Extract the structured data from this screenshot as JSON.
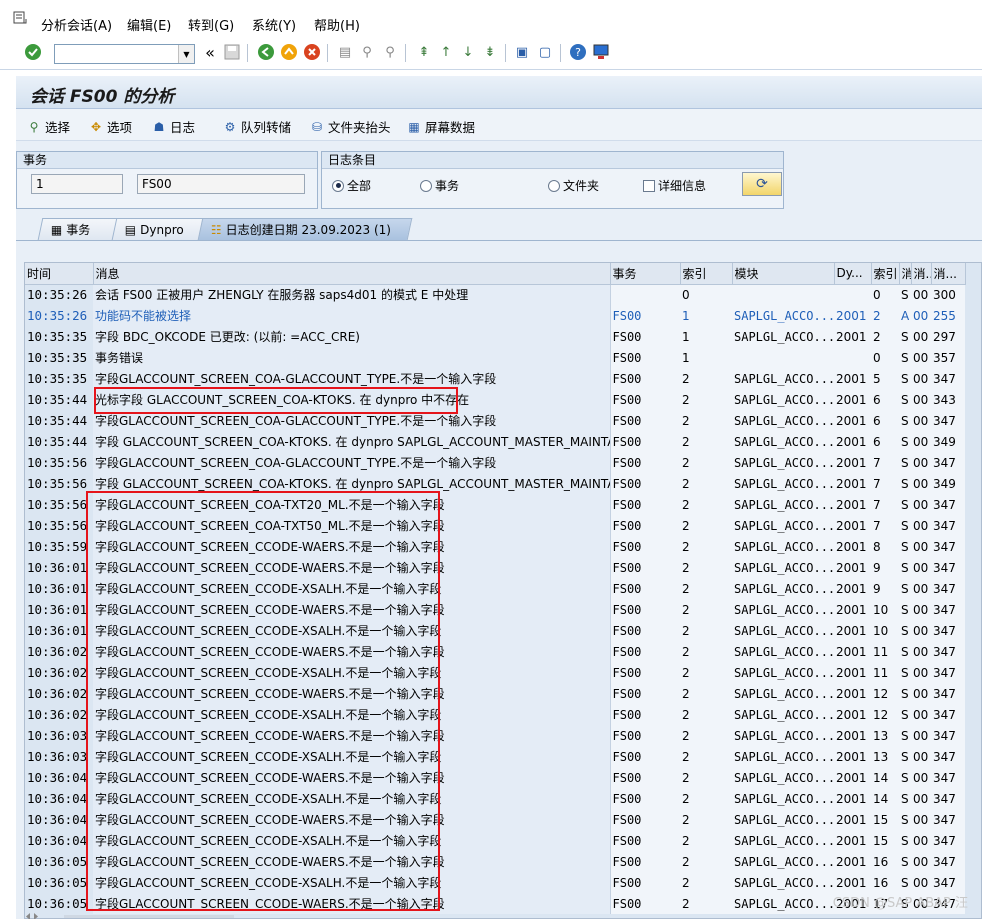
{
  "menu": {
    "items": [
      "分析会话(A)",
      "编辑(E)",
      "转到(G)",
      "系统(Y)",
      "帮助(H)"
    ]
  },
  "toolbar": {
    "command_value": "",
    "back_glyph": "«"
  },
  "title": "会话 FS00 的分析",
  "app_toolbar": {
    "buttons": [
      "选择",
      "选项",
      "日志",
      "队列转储",
      "文件夹抬头",
      "屏幕数据"
    ]
  },
  "transaction_group": {
    "header": "事务",
    "field1": "1",
    "field2": "FS00"
  },
  "log_group": {
    "header": "日志条目",
    "options": [
      "全部",
      "事务",
      "文件夹"
    ],
    "selected": "全部",
    "checkbox_label": "详细信息"
  },
  "tabs": [
    "事务",
    "Dynpro",
    "日志创建日期 23.09.2023 (1)"
  ],
  "table": {
    "headers": [
      "时间",
      "消息",
      "事务",
      "索引",
      "模块",
      "Dy...",
      "索引",
      "消",
      "消...",
      "消..."
    ],
    "rows": [
      [
        "10:35:26",
        "会话 FS00 正被用户 ZHENGLY 在服务器 saps4d01 的模式 E 中处理",
        "",
        "0",
        "",
        "",
        "0",
        "S",
        "00",
        "300"
      ],
      [
        "10:35:26",
        "功能码不能被选择",
        "FS00",
        "1",
        "SAPLGL_ACCO...",
        "2001",
        "2",
        "A",
        "00",
        "255"
      ],
      [
        "10:35:35",
        "字段 BDC_OKCODE 已更改: (以前: =ACC_CRE)",
        "FS00",
        "1",
        "SAPLGL_ACCO...",
        "2001",
        "2",
        "S",
        "00",
        "297"
      ],
      [
        "10:35:35",
        "事务错误",
        "FS00",
        "1",
        "",
        "",
        "0",
        "S",
        "00",
        "357"
      ],
      [
        "10:35:35",
        "字段GLACCOUNT_SCREEN_COA-GLACCOUNT_TYPE.不是一个输入字段",
        "FS00",
        "2",
        "SAPLGL_ACCO...",
        "2001",
        "5",
        "S",
        "00",
        "347"
      ],
      [
        "10:35:44",
        "光标字段 GLACCOUNT_SCREEN_COA-KTOKS. 在 dynpro 中不存在",
        "FS00",
        "2",
        "SAPLGL_ACCO...",
        "2001",
        "6",
        "S",
        "00",
        "343"
      ],
      [
        "10:35:44",
        "字段GLACCOUNT_SCREEN_COA-GLACCOUNT_TYPE.不是一个输入字段",
        "FS00",
        "2",
        "SAPLGL_ACCO...",
        "2001",
        "6",
        "S",
        "00",
        "347"
      ],
      [
        "10:35:44",
        "字段 GLACCOUNT_SCREEN_COA-KTOKS. 在 dynpro SAPLGL_ACCOUNT_MASTER_MAINTAIN...",
        "FS00",
        "2",
        "SAPLGL_ACCO...",
        "2001",
        "6",
        "S",
        "00",
        "349"
      ],
      [
        "10:35:56",
        "字段GLACCOUNT_SCREEN_COA-GLACCOUNT_TYPE.不是一个输入字段",
        "FS00",
        "2",
        "SAPLGL_ACCO...",
        "2001",
        "7",
        "S",
        "00",
        "347"
      ],
      [
        "10:35:56",
        "字段 GLACCOUNT_SCREEN_COA-KTOKS. 在 dynpro SAPLGL_ACCOUNT_MASTER_MAINTAIN...",
        "FS00",
        "2",
        "SAPLGL_ACCO...",
        "2001",
        "7",
        "S",
        "00",
        "349"
      ],
      [
        "10:35:56",
        "字段GLACCOUNT_SCREEN_COA-TXT20_ML.不是一个输入字段",
        "FS00",
        "2",
        "SAPLGL_ACCO...",
        "2001",
        "7",
        "S",
        "00",
        "347"
      ],
      [
        "10:35:56",
        "字段GLACCOUNT_SCREEN_COA-TXT50_ML.不是一个输入字段",
        "FS00",
        "2",
        "SAPLGL_ACCO...",
        "2001",
        "7",
        "S",
        "00",
        "347"
      ],
      [
        "10:35:59",
        "字段GLACCOUNT_SCREEN_CCODE-WAERS.不是一个输入字段",
        "FS00",
        "2",
        "SAPLGL_ACCO...",
        "2001",
        "8",
        "S",
        "00",
        "347"
      ],
      [
        "10:36:01",
        "字段GLACCOUNT_SCREEN_CCODE-WAERS.不是一个输入字段",
        "FS00",
        "2",
        "SAPLGL_ACCO...",
        "2001",
        "9",
        "S",
        "00",
        "347"
      ],
      [
        "10:36:01",
        "字段GLACCOUNT_SCREEN_CCODE-XSALH.不是一个输入字段",
        "FS00",
        "2",
        "SAPLGL_ACCO...",
        "2001",
        "9",
        "S",
        "00",
        "347"
      ],
      [
        "10:36:01",
        "字段GLACCOUNT_SCREEN_CCODE-WAERS.不是一个输入字段",
        "FS00",
        "2",
        "SAPLGL_ACCO...",
        "2001",
        "10",
        "S",
        "00",
        "347"
      ],
      [
        "10:36:01",
        "字段GLACCOUNT_SCREEN_CCODE-XSALH.不是一个输入字段",
        "FS00",
        "2",
        "SAPLGL_ACCO...",
        "2001",
        "10",
        "S",
        "00",
        "347"
      ],
      [
        "10:36:02",
        "字段GLACCOUNT_SCREEN_CCODE-WAERS.不是一个输入字段",
        "FS00",
        "2",
        "SAPLGL_ACCO...",
        "2001",
        "11",
        "S",
        "00",
        "347"
      ],
      [
        "10:36:02",
        "字段GLACCOUNT_SCREEN_CCODE-XSALH.不是一个输入字段",
        "FS00",
        "2",
        "SAPLGL_ACCO...",
        "2001",
        "11",
        "S",
        "00",
        "347"
      ],
      [
        "10:36:02",
        "字段GLACCOUNT_SCREEN_CCODE-WAERS.不是一个输入字段",
        "FS00",
        "2",
        "SAPLGL_ACCO...",
        "2001",
        "12",
        "S",
        "00",
        "347"
      ],
      [
        "10:36:02",
        "字段GLACCOUNT_SCREEN_CCODE-XSALH.不是一个输入字段",
        "FS00",
        "2",
        "SAPLGL_ACCO...",
        "2001",
        "12",
        "S",
        "00",
        "347"
      ],
      [
        "10:36:03",
        "字段GLACCOUNT_SCREEN_CCODE-WAERS.不是一个输入字段",
        "FS00",
        "2",
        "SAPLGL_ACCO...",
        "2001",
        "13",
        "S",
        "00",
        "347"
      ],
      [
        "10:36:03",
        "字段GLACCOUNT_SCREEN_CCODE-XSALH.不是一个输入字段",
        "FS00",
        "2",
        "SAPLGL_ACCO...",
        "2001",
        "13",
        "S",
        "00",
        "347"
      ],
      [
        "10:36:04",
        "字段GLACCOUNT_SCREEN_CCODE-WAERS.不是一个输入字段",
        "FS00",
        "2",
        "SAPLGL_ACCO...",
        "2001",
        "14",
        "S",
        "00",
        "347"
      ],
      [
        "10:36:04",
        "字段GLACCOUNT_SCREEN_CCODE-XSALH.不是一个输入字段",
        "FS00",
        "2",
        "SAPLGL_ACCO...",
        "2001",
        "14",
        "S",
        "00",
        "347"
      ],
      [
        "10:36:04",
        "字段GLACCOUNT_SCREEN_CCODE-WAERS.不是一个输入字段",
        "FS00",
        "2",
        "SAPLGL_ACCO...",
        "2001",
        "15",
        "S",
        "00",
        "347"
      ],
      [
        "10:36:04",
        "字段GLACCOUNT_SCREEN_CCODE-XSALH.不是一个输入字段",
        "FS00",
        "2",
        "SAPLGL_ACCO...",
        "2001",
        "15",
        "S",
        "00",
        "347"
      ],
      [
        "10:36:05",
        "字段GLACCOUNT_SCREEN_CCODE-WAERS.不是一个输入字段",
        "FS00",
        "2",
        "SAPLGL_ACCO...",
        "2001",
        "16",
        "S",
        "00",
        "347"
      ],
      [
        "10:36:05",
        "字段GLACCOUNT_SCREEN_CCODE-XSALH.不是一个输入字段",
        "FS00",
        "2",
        "SAPLGL_ACCO...",
        "2001",
        "16",
        "S",
        "00",
        "347"
      ],
      [
        "10:36:05",
        "字段GLACCOUNT_SCREEN_CCODE-WAERS.不是一个输入字段",
        "FS00",
        "2",
        "SAPLGL_ACCO...",
        "2001",
        "17",
        "S",
        "00",
        "347"
      ]
    ],
    "highlighted_message_color": "#1f5fb8"
  },
  "watermark": "CSDN @SAP ABAP 汪"
}
